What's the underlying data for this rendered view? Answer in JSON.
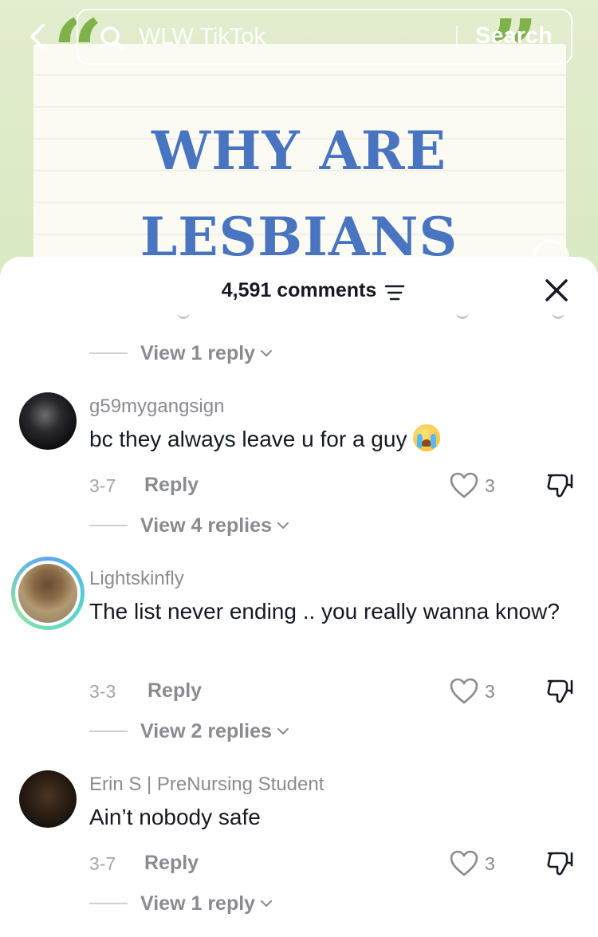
{
  "topbar": {
    "search_value": "WLW TikTok",
    "search_button": "Search"
  },
  "video": {
    "title_line1": "WHY ARE",
    "title_line2": "LESBIANS"
  },
  "comments_sheet": {
    "count_label": "4,591 comments",
    "top_view_replies": "View 1 reply",
    "comments": [
      {
        "username": "g59mygangsign",
        "text": "bc they always leave u for a guy",
        "emoji": "loudly-crying-face",
        "date": "3-7",
        "reply_label": "Reply",
        "likes": "3",
        "view_replies": "View 4 replies"
      },
      {
        "username": "Lightskinfly",
        "text": "The list never ending .. you really wanna know?",
        "date": "3-3",
        "reply_label": "Reply",
        "likes": "3",
        "view_replies": "View 2 replies"
      },
      {
        "username": "Erin S | PreNursing Student",
        "text": "Ain’t nobody safe",
        "date": "3-7",
        "reply_label": "Reply",
        "likes": "3",
        "view_replies": "View 1 reply"
      }
    ]
  },
  "colors": {
    "title_blue": "#4874c0",
    "quote_green": "#7fb24a",
    "text_dark": "#161823",
    "text_muted": "#8a8b91"
  }
}
